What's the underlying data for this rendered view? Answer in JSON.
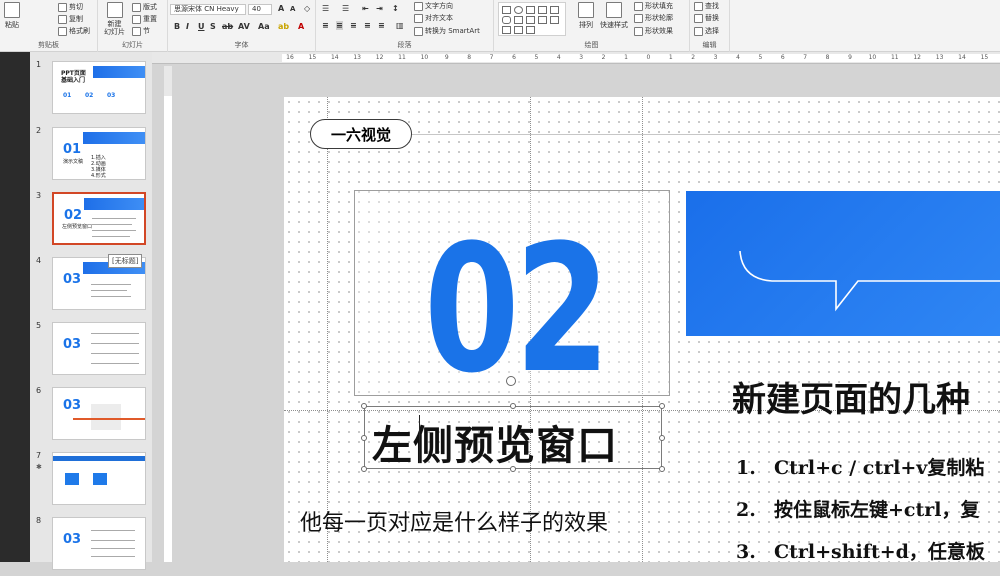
{
  "ribbon": {
    "clipboard": {
      "paste": "粘贴",
      "cut": "剪切",
      "copy": "复制",
      "format_painter": "格式刷",
      "group_label": "剪贴板"
    },
    "slides": {
      "new_slide": "新建\n幻灯片",
      "layout": "版式",
      "reset": "重置",
      "section": "节",
      "group_label": "幻灯片"
    },
    "font": {
      "font_name": "思源宋体 CN Heavy",
      "font_size": "40",
      "group_label": "字体"
    },
    "paragraph": {
      "text_direction": "文字方向",
      "align_text": "对齐文本",
      "smartart": "转换为 SmartArt",
      "group_label": "段落"
    },
    "drawing": {
      "arrange": "排列",
      "quick_styles": "快速样式",
      "shape_fill": "形状填充",
      "shape_outline": "形状轮廓",
      "shape_effects": "形状效果",
      "group_label": "绘图"
    },
    "editing": {
      "find": "查找",
      "replace": "替换",
      "select": "选择",
      "group_label": "编辑"
    }
  },
  "thumbnails": [
    {
      "num": "1",
      "big": "",
      "title": "PPT页面\n基础入门",
      "items": [
        "01",
        "02",
        "03"
      ]
    },
    {
      "num": "2",
      "big": "01",
      "title": "演示文稿",
      "items": [
        "1.插入",
        "2.动画",
        "3.媒体",
        "4.形式"
      ]
    },
    {
      "num": "3",
      "big": "02",
      "title": "左侧预览窗口",
      "items": []
    },
    {
      "num": "4",
      "big": "03",
      "title": "",
      "items": []
    },
    {
      "num": "5",
      "big": "03",
      "title": "",
      "items": []
    },
    {
      "num": "6",
      "big": "03",
      "title": "",
      "items": []
    },
    {
      "num": "7",
      "big": "",
      "title": "",
      "items": []
    },
    {
      "num": "8",
      "big": "03",
      "title": "",
      "items": []
    }
  ],
  "tooltip": "[无标题]",
  "ruler_ticks": [
    "16",
    "15",
    "14",
    "13",
    "12",
    "11",
    "10",
    "9",
    "8",
    "7",
    "6",
    "5",
    "4",
    "3",
    "2",
    "1",
    "0",
    "1",
    "2",
    "3",
    "4",
    "5",
    "6",
    "7",
    "8",
    "9",
    "10",
    "11",
    "12",
    "13",
    "14",
    "15",
    "16"
  ],
  "slide": {
    "brand": "一六视觉",
    "big_number": "02",
    "title": "左侧预览窗口",
    "subtitle": "他每一页对应是什么样子的效果",
    "right_heading": "新建页面的几种",
    "list": [
      {
        "n": "1.",
        "text": "Ctrl+c / ctrl+v复制粘"
      },
      {
        "n": "2.",
        "text": "按住鼠标左键+ctrl，复"
      },
      {
        "n": "3.",
        "text": "Ctrl+shift+d，任意板"
      }
    ]
  },
  "colors": {
    "accent": "#1a73e8",
    "selection": "#d24726"
  }
}
